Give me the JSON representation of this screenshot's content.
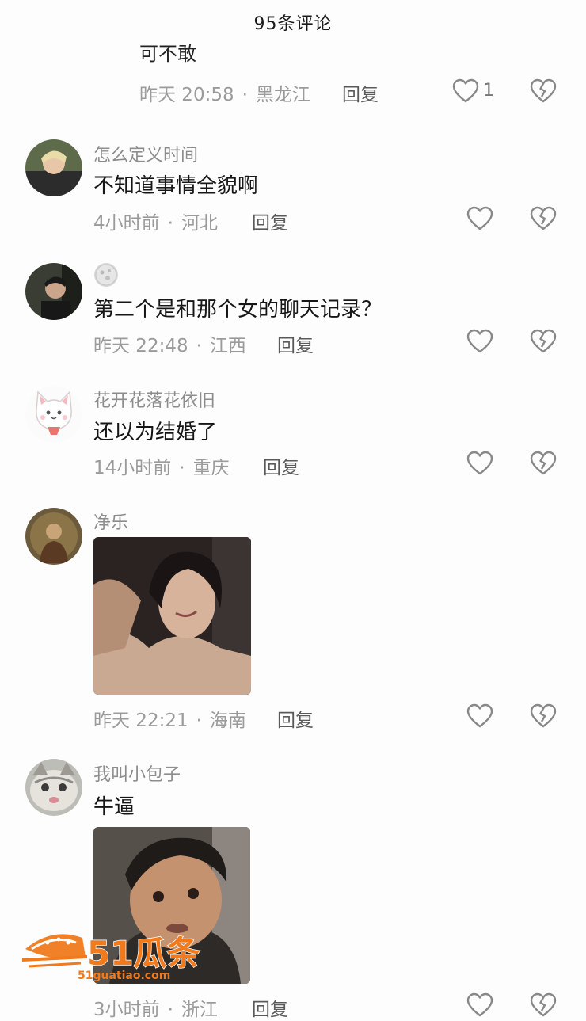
{
  "header": {
    "title": "95条评论"
  },
  "top_partial": {
    "text_fragment": "可不敢",
    "time": "昨天 20:58",
    "location": "黑龙江",
    "reply": "回复",
    "like_count": "1"
  },
  "comments": [
    {
      "user": "怎么定义时间",
      "text": "不知道事情全貌啊",
      "time": "4小时前",
      "location": "河北",
      "reply": "回复"
    },
    {
      "user": "",
      "text": "第二个是和那个女的聊天记录？",
      "time": "昨天 22:48",
      "location": "江西",
      "reply": "回复"
    },
    {
      "user": "花开花落花依旧",
      "text": "还以为结婚了",
      "time": "14小时前",
      "location": "重庆",
      "reply": "回复"
    },
    {
      "user": "净乐",
      "text": "",
      "time": "昨天 22:21",
      "location": "海南",
      "reply": "回复"
    },
    {
      "user": "我叫小包子",
      "text": "牛逼",
      "time": "3小时前",
      "location": "浙江",
      "reply": "回复"
    }
  ],
  "watermark": {
    "brand": "51瓜条",
    "url": "51guatiao.com"
  },
  "icons": {
    "like": "heart-outline-icon",
    "dislike": "broken-heart-icon"
  },
  "colors": {
    "meta": "#9b9b9b",
    "username": "#8d8d8d",
    "watermark": "#f07a1c"
  }
}
